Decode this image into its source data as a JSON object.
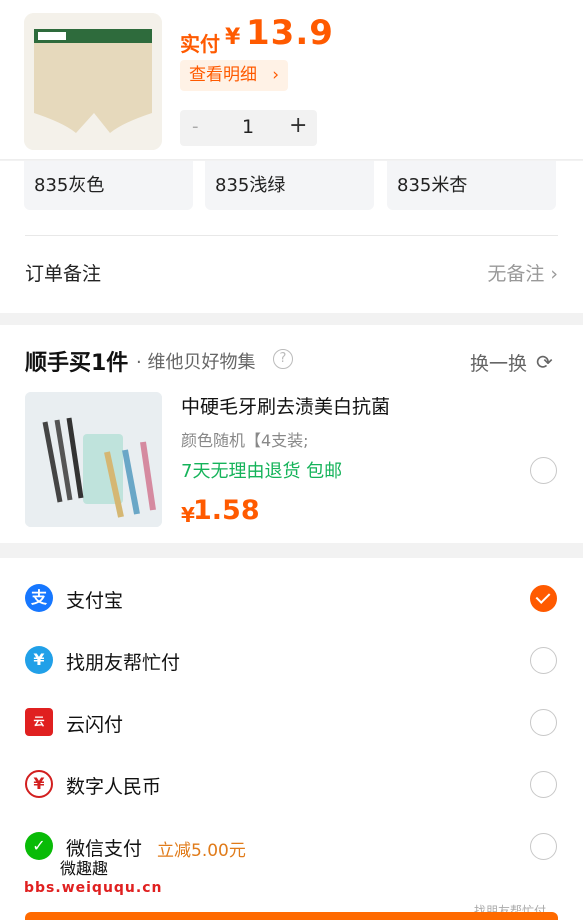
{
  "header": {
    "pay_label": "实付",
    "currency": "¥",
    "amount": "13.9",
    "detail_button": "查看明细",
    "qty_minus": "-",
    "qty_value": "1",
    "qty_plus": "+"
  },
  "options": [
    "835灰色",
    "835浅绿",
    "835米杏"
  ],
  "order_note": {
    "label": "订单备注",
    "value": "无备注"
  },
  "addon": {
    "title": "顺手买1件",
    "subtitle": "· 维他贝好物集",
    "swap_label": "换一换",
    "product": {
      "name": "中硬毛牙刷去渍美白抗菌",
      "spec": "颜色随机【4支装;",
      "tags": "7天无理由退货  包邮",
      "currency": "¥",
      "price": "1.58"
    }
  },
  "payment_methods": [
    {
      "name": "支付宝",
      "icon": "alipay-icon",
      "color": "#1677ff",
      "glyph": "支",
      "checked": true,
      "promo": ""
    },
    {
      "name": "找朋友帮忙付",
      "icon": "friend-pay-icon",
      "color": "#21a0e8",
      "glyph": "¥",
      "checked": false,
      "promo": ""
    },
    {
      "name": "云闪付",
      "icon": "unionpay-icon",
      "color": "#e02020",
      "glyph": "云",
      "checked": false,
      "promo": ""
    },
    {
      "name": "数字人民币",
      "icon": "digital-rmb-icon",
      "color": "#d21f1f",
      "glyph": "¥",
      "checked": false,
      "promo": ""
    },
    {
      "name": "微信支付",
      "icon": "wechat-pay-icon",
      "color": "#09bb07",
      "glyph": "✓",
      "checked": false,
      "promo": "立减5.00元"
    }
  ],
  "watermark": {
    "text": "微趣趣",
    "url": "bbs.weiququ.cn",
    "right_text": "找朋友帮忙付"
  },
  "colors": {
    "accent": "#ff5a00",
    "green": "#15b35a"
  }
}
